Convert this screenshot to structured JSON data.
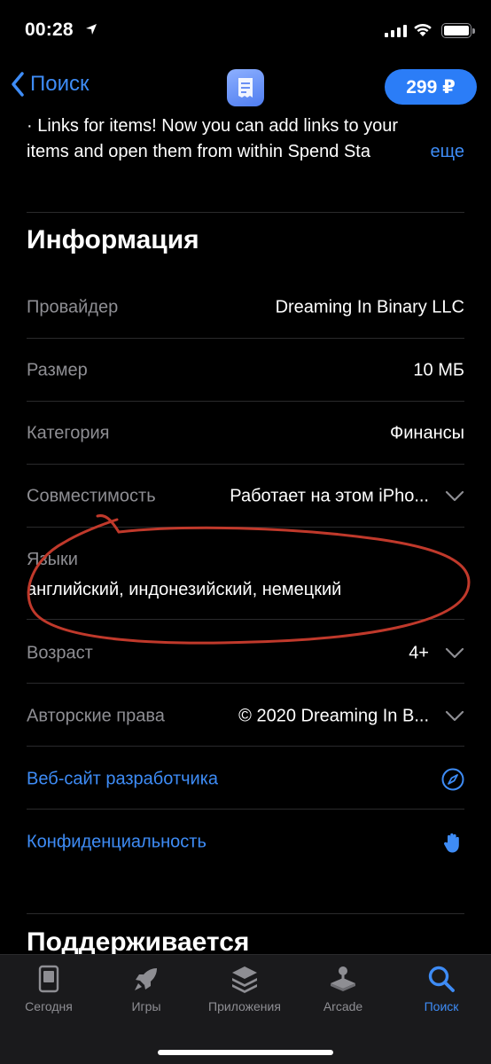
{
  "status_bar": {
    "time": "00:28"
  },
  "nav": {
    "back_label": "Поиск",
    "price_label": "299 ₽"
  },
  "whatsnew": {
    "line1": "· Links for items! Now you can add links to your",
    "line2": "items and open them from within Spend Sta",
    "more_label": "еще"
  },
  "info": {
    "title": "Информация",
    "rows": [
      {
        "label": "Провайдер",
        "value": "Dreaming In Binary LLC"
      },
      {
        "label": "Размер",
        "value": "10 МБ"
      },
      {
        "label": "Категория",
        "value": "Финансы"
      },
      {
        "label": "Совместимость",
        "value": "Работает на этом iPho..."
      },
      {
        "label": "Языки",
        "value": "английский, индонезийский, немецкий"
      },
      {
        "label": "Возраст",
        "value": "4+"
      },
      {
        "label": "Авторские права",
        "value": "© 2020 Dreaming In B..."
      }
    ],
    "developer_site": "Веб-сайт разработчика",
    "privacy": "Конфиденциальность"
  },
  "supported": {
    "title": "Поддерживается"
  },
  "tabs": [
    {
      "label": "Сегодня",
      "icon": "today-icon",
      "active": false
    },
    {
      "label": "Игры",
      "icon": "rocket-icon",
      "active": false
    },
    {
      "label": "Приложения",
      "icon": "apps-stack-icon",
      "active": false
    },
    {
      "label": "Arcade",
      "icon": "joystick-icon",
      "active": false
    },
    {
      "label": "Поиск",
      "icon": "search-icon",
      "active": true
    }
  ],
  "colors": {
    "accent": "#3e8cf6",
    "background": "#000000",
    "secondary_text": "#8e8e93",
    "annotation": "#c0392b"
  }
}
